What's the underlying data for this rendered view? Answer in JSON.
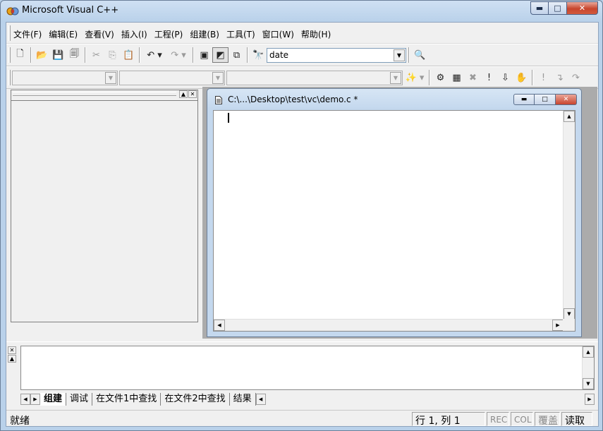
{
  "app": {
    "title": "Microsoft Visual C++"
  },
  "window_controls": {
    "minimize": "▬",
    "maximize": "□",
    "close": "✕"
  },
  "menu": [
    {
      "label": "文件(F)"
    },
    {
      "label": "编辑(E)"
    },
    {
      "label": "查看(V)"
    },
    {
      "label": "插入(I)"
    },
    {
      "label": "工程(P)"
    },
    {
      "label": "组建(B)"
    },
    {
      "label": "工具(T)"
    },
    {
      "label": "窗口(W)"
    },
    {
      "label": "帮助(H)"
    }
  ],
  "toolbar": {
    "find_combo_value": "date",
    "icons": {
      "new": "new-file-icon",
      "open": "open-folder-icon",
      "save": "save-icon",
      "save_all": "save-all-icon",
      "cut": "cut-icon",
      "copy": "copy-icon",
      "paste": "paste-icon",
      "undo": "undo-icon",
      "redo": "redo-icon"
    }
  },
  "document": {
    "title": "C:\\...\\Desktop\\test\\vc\\demo.c *"
  },
  "output": {
    "tabs": [
      {
        "label": "组建",
        "active": true
      },
      {
        "label": "调试",
        "active": false
      },
      {
        "label": "在文件1中查找",
        "active": false
      },
      {
        "label": "在文件2中查找",
        "active": false
      },
      {
        "label": "结果",
        "active": false
      }
    ]
  },
  "status": {
    "ready": "就绪",
    "position": "行 1, 列 1",
    "rec": "REC",
    "col": "COL",
    "ovr": "覆盖",
    "read": "读取"
  },
  "colors": {
    "title_bar": "#b9d1ea",
    "close_button": "#c7452d",
    "face": "#f0f0f0"
  }
}
